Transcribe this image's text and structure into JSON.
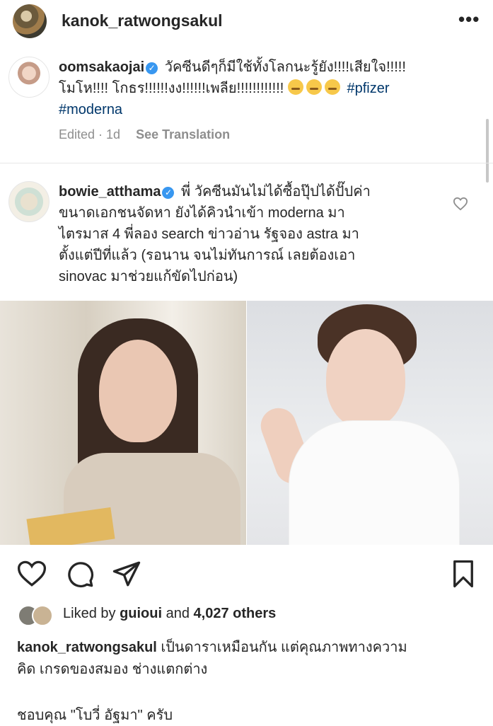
{
  "header": {
    "username": "kanok_ratwongsakul",
    "more_label": "•••"
  },
  "comments": [
    {
      "username": "oomsakaojai",
      "verified_mark": "✓",
      "text_line1": "วัคซีนดีๆก็มีใช้ทั้งโลกนะรู้ยัง!!!!เสียใจ!!!!!",
      "text_line2": "โมโห!!!! โกธร!!!!!!งง!!!!!!เพลีย!!!!!!!!!!!!",
      "hashtag1": "#pfizer",
      "hashtag2": "#moderna",
      "edited_label": "Edited · 1d",
      "see_translation": "See Translation"
    },
    {
      "username": "bowie_atthama",
      "verified_mark": "✓",
      "text_line1": "พี่ วัคซีนมันไม่ได้ซื้อปุ๊ปได้ปั๊ปค่า",
      "text_line2": "ขนาดเอกชนจัดหา ยังได้คิวนำเข้า moderna มา",
      "text_line3": "ไตรมาส 4 พี่ลอง search ข่าวอ่าน รัฐจอง astra มา",
      "text_line4": "ตั้งแต่ปีที่แล้ว (รอนาน จนไม่ทันการณ์ เลยต้องเอา",
      "text_line5": "sinovac มาช่วยแก้ขัดไปก่อน)"
    }
  ],
  "likes": {
    "prefix": "Liked by ",
    "user": "guioui",
    "middle": " and ",
    "count": "4,027 others"
  },
  "caption": {
    "username": "kanok_ratwongsakul",
    "text_line1": " เป็นดาราเหมือนกัน แต่คุณภาพทางความ",
    "text_line2": "คิด เกรดของสมอง ช่างแตกต่าง",
    "text_line3": "ชอบคุณ \"โบวี่ อัฐมา\" ครับ"
  },
  "icons": {
    "like": "heart-icon",
    "comment": "comment-icon",
    "share": "paper-plane-icon",
    "save": "bookmark-icon",
    "comment_like": "heart-outline-icon"
  }
}
